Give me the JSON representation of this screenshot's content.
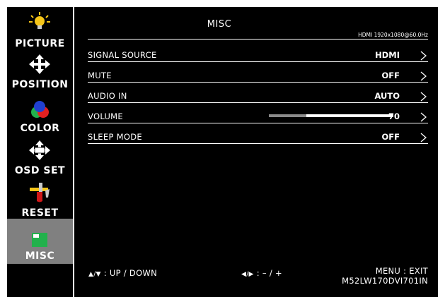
{
  "sidebar": {
    "items": [
      {
        "label": "PICTURE",
        "icon": "lightbulb-icon"
      },
      {
        "label": "POSITION",
        "icon": "move-arrows-icon"
      },
      {
        "label": "COLOR",
        "icon": "rgb-circles-icon"
      },
      {
        "label": "OSD SET",
        "icon": "osd-arrows-icon"
      },
      {
        "label": "RESET",
        "icon": "reset-tools-icon"
      },
      {
        "label": "MISC",
        "icon": "misc-window-icon",
        "active": true
      }
    ]
  },
  "main": {
    "title": "MISC",
    "signal_info": "HDMI  1920x1080@60.0Hz",
    "rows": [
      {
        "name": "SIGNAL SOURCE",
        "value": "HDMI"
      },
      {
        "name": "MUTE",
        "value": "OFF"
      },
      {
        "name": "AUDIO  IN",
        "value": "AUTO"
      },
      {
        "name": "VOLUME",
        "value": "70",
        "level": 0.3
      },
      {
        "name": "SLEEP MODE",
        "value": "OFF"
      }
    ]
  },
  "footer": {
    "updown_glyph": "▲/▼",
    "updown_text": ": UP / DOWN",
    "leftright_glyph": "◀/▶",
    "leftright_text": ": – / +",
    "exit_text": "MENU : EXIT",
    "model": "M52LW170DVI701IN"
  },
  "colors": {
    "background": "#000000",
    "active_item": "#808080",
    "text": "#ffffff",
    "slider_fill": "#8a8a8a",
    "icon_green": "#22b14c",
    "icon_yellow": "#f5c518"
  }
}
